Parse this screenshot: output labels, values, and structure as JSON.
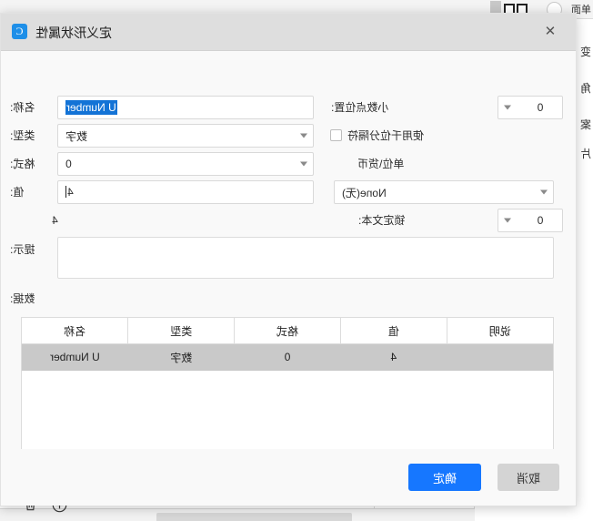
{
  "dialog": {
    "title": "定义形状属性",
    "logo_glyph": "C",
    "close_label": "✕"
  },
  "form": {
    "name_label": "名称:",
    "name_value": "U Number",
    "decimal_label": "小数点位置:",
    "decimal_value": "0",
    "type_label": "类型:",
    "type_value": "数字",
    "thousands_label": "使用千位分隔符",
    "format_label": "格式:",
    "format_value": "0",
    "unit_label": "单位\\货币",
    "value_label": "值:",
    "value_value": "4",
    "none_value": "None(无)",
    "locktext_label": "锁定文本:",
    "locktext_value": "0",
    "tip_label": "提示:",
    "tip_value": "",
    "data_label": "数据:"
  },
  "table": {
    "columns": [
      "名称",
      "类型",
      "格式",
      "值",
      "说明"
    ],
    "rows": [
      {
        "name": "U Number",
        "type": "数字",
        "format": "0",
        "value": "4",
        "desc": ""
      }
    ]
  },
  "actions": {
    "add_icon": "add-icon",
    "delete_icon": "delete-icon",
    "confirm_label": "确定",
    "cancel_label": "取消"
  },
  "background": {
    "toolbar_items": [
      "单面"
    ],
    "side_labels": [
      "变",
      "角",
      "案",
      "片"
    ],
    "right_labels": [
      "名称",
      "类型",
      "格式",
      "值",
      "提示",
      "数据"
    ]
  }
}
